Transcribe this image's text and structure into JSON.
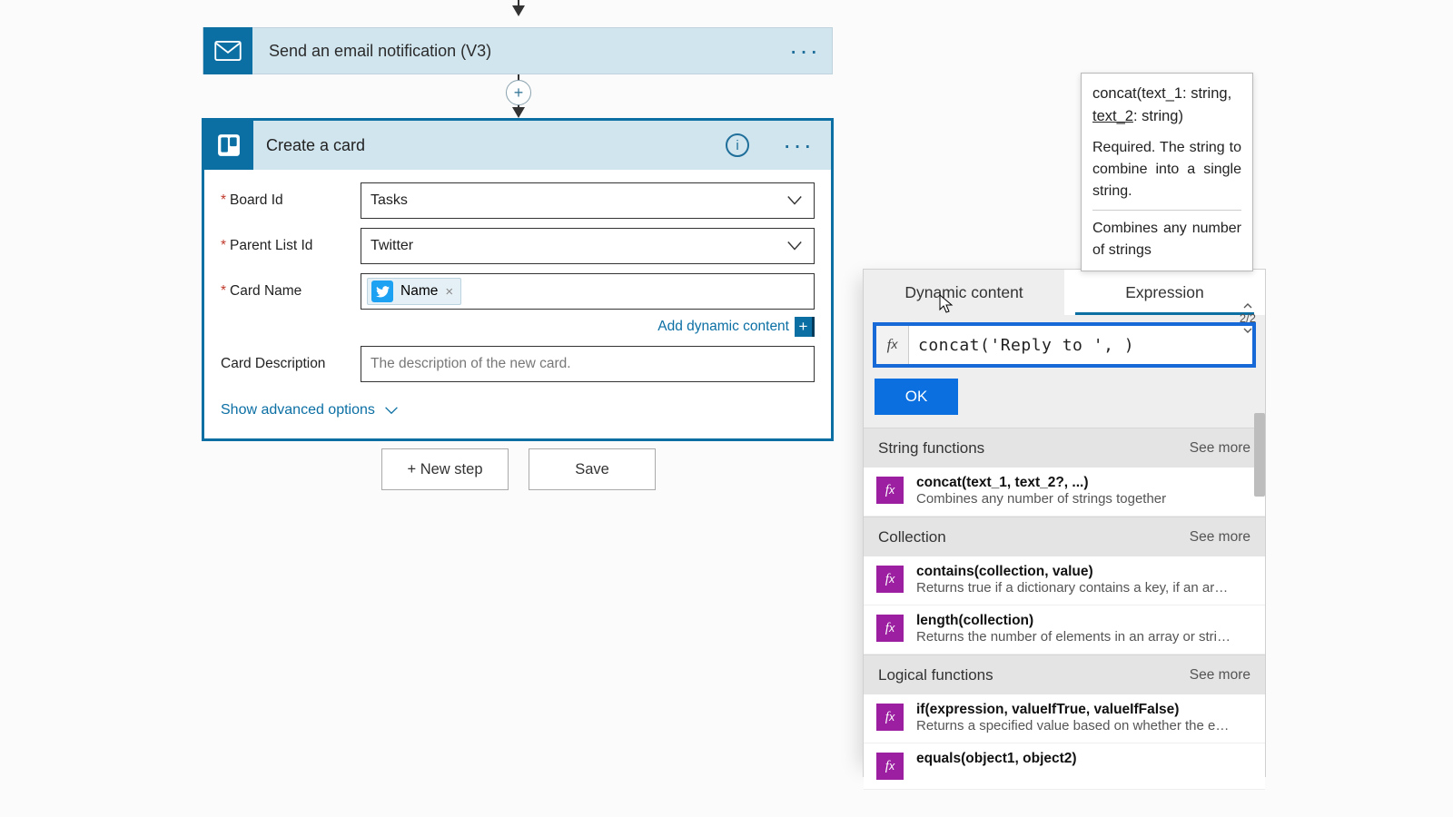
{
  "flow": {
    "email_action": {
      "title": "Send an email notification (V3)"
    },
    "create_card": {
      "title": "Create a card",
      "fields": {
        "board_id": {
          "label": "Board Id",
          "value": "Tasks",
          "required": true
        },
        "parent_list_id": {
          "label": "Parent List Id",
          "value": "Twitter",
          "required": true
        },
        "card_name": {
          "label": "Card Name",
          "token": "Name",
          "required": true
        },
        "card_description": {
          "label": "Card Description",
          "placeholder": "The description of the new card."
        }
      },
      "add_dynamic_content": "Add dynamic content",
      "show_advanced": "Show advanced options"
    },
    "buttons": {
      "new_step": "+ New step",
      "save": "Save"
    }
  },
  "expr": {
    "tabs": {
      "dynamic": "Dynamic content",
      "expression": "Expression"
    },
    "page_indicator": "2/2",
    "fx_value": "concat('Reply to ', )",
    "ok": "OK",
    "groups": [
      {
        "name": "String functions",
        "see_more": "See more",
        "items": [
          {
            "sig": "concat(text_1, text_2?, ...)",
            "desc": "Combines any number of strings together"
          }
        ]
      },
      {
        "name": "Collection",
        "see_more": "See more",
        "items": [
          {
            "sig": "contains(collection, value)",
            "desc": "Returns true if a dictionary contains a key, if an array contains a value, or if a string contains a substring"
          },
          {
            "sig": "length(collection)",
            "desc": "Returns the number of elements in an array or string"
          }
        ]
      },
      {
        "name": "Logical functions",
        "see_more": "See more",
        "items": [
          {
            "sig": "if(expression, valueIfTrue, valueIfFalse)",
            "desc": "Returns a specified value based on whether the expression resulted in true or false"
          },
          {
            "sig": "equals(object1, object2)",
            "desc": ""
          }
        ]
      }
    ]
  },
  "tooltip": {
    "sig_pre": "concat(text_1: string, ",
    "sig_arg": "text_2",
    "sig_post": ": string)",
    "req": "Required. The string to combine into a single string.",
    "foot": "Combines any number of strings"
  }
}
